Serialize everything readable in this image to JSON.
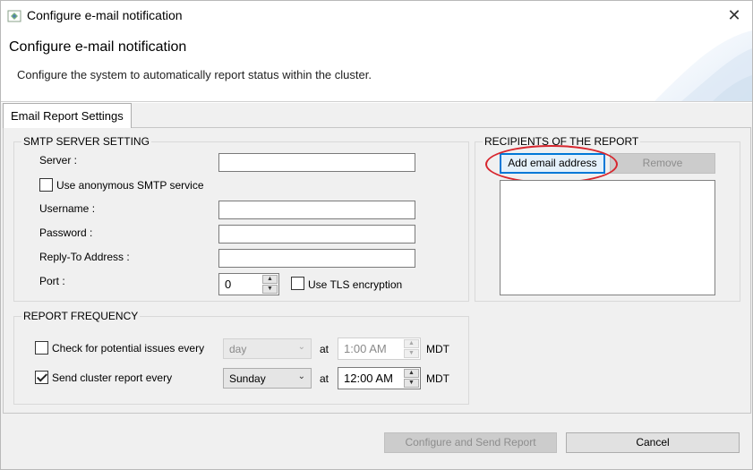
{
  "window": {
    "title": "Configure e-mail notification",
    "close_glyph": "✕"
  },
  "header": {
    "title": "Configure e-mail notification",
    "description": "Configure the system to automatically report status within the cluster."
  },
  "tabs": [
    {
      "label": "Email Report Settings",
      "selected": true
    }
  ],
  "smtp": {
    "legend": "SMTP SERVER SETTING",
    "server_label": "Server :",
    "server_value": "",
    "anonymous_label": "Use anonymous SMTP service",
    "anonymous_checked": false,
    "username_label": "Username :",
    "username_value": "",
    "password_label": "Password :",
    "password_value": "",
    "reply_to_label": "Reply-To Address :",
    "reply_to_value": "",
    "port_label": "Port :",
    "port_value": "0",
    "tls_label": "Use TLS encryption",
    "tls_checked": false
  },
  "recipients": {
    "legend": "RECIPIENTS OF THE REPORT",
    "add_label": "Add email address",
    "remove_label": "Remove",
    "list_items": []
  },
  "frequency": {
    "legend": "REPORT FREQUENCY",
    "issues_label": "Check for potential issues every",
    "issues_checked": false,
    "issues_period": "day",
    "issues_at": "at",
    "issues_time": "1:00 AM",
    "issues_tz": "MDT",
    "report_label": "Send cluster report every",
    "report_checked": true,
    "report_period": "Sunday",
    "report_at": "at",
    "report_time": "12:00 AM",
    "report_tz": "MDT"
  },
  "footer": {
    "configure_label": "Configure and Send Report",
    "cancel_label": "Cancel"
  },
  "colors": {
    "highlight": "#d7262e",
    "focus": "#0078d7"
  }
}
